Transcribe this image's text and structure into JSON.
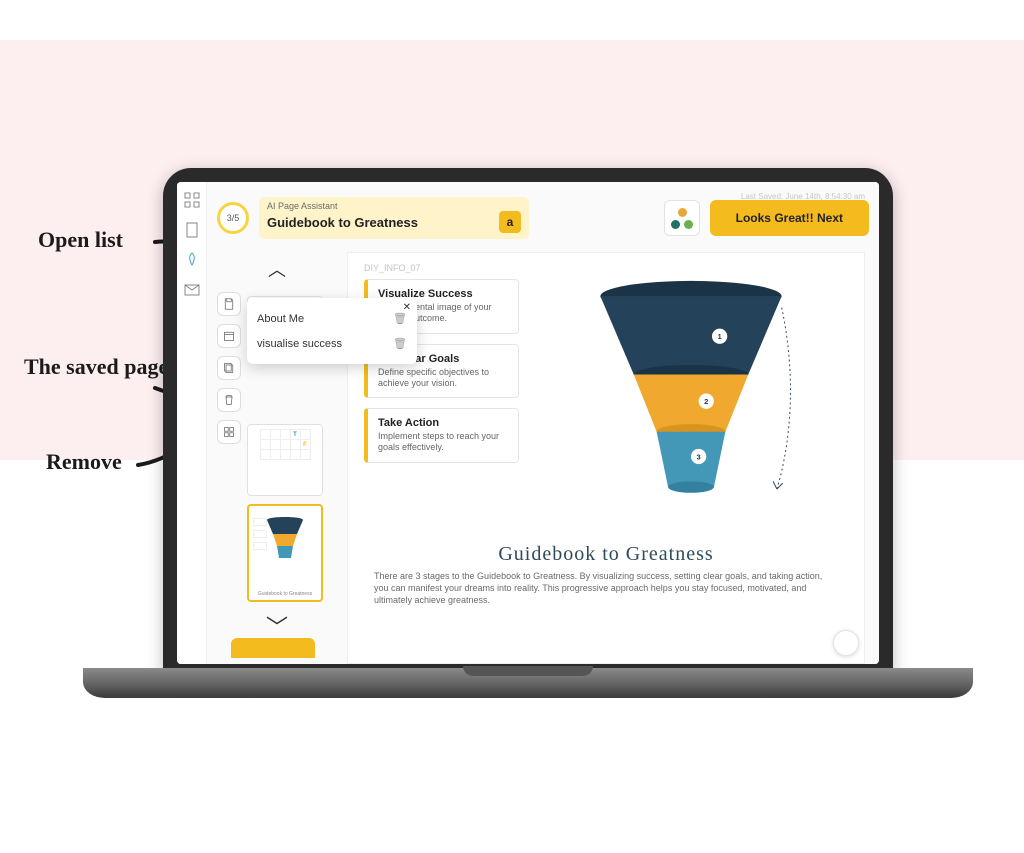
{
  "annotations": {
    "open_list": "Open list",
    "saved_page": "The saved page",
    "remove": "Remove"
  },
  "header": {
    "progress": "3/5",
    "assistant_label": "AI Page Assistant",
    "assistant_title": "Guidebook to Greatness",
    "next_label": "Looks Great!! Next",
    "last_saved": "Last Saved: June 14th, 8:54:30 am"
  },
  "popout": {
    "items": [
      {
        "label": "About Me"
      },
      {
        "label": "visualise success"
      }
    ]
  },
  "canvas": {
    "label": "DIY_INFO_07",
    "steps": [
      {
        "title": "Visualize Success",
        "desc": "Create mental image of your desired outcome."
      },
      {
        "title": "Set Clear Goals",
        "desc": "Define specific objectives to achieve your vision."
      },
      {
        "title": "Take Action",
        "desc": "Implement steps to reach your goals effectively."
      }
    ],
    "title": "Guidebook to Greatness",
    "desc": "There are 3 stages to the Guidebook to Greatness. By visualizing success, setting clear goals, and taking action, you can manifest your dreams into reality. This progressive approach helps you stay focused, motivated, and ultimately achieve greatness."
  },
  "chart_data": {
    "type": "other",
    "shape": "funnel",
    "stages": [
      {
        "index": 1,
        "label": "Visualize Success",
        "color": "#24425a"
      },
      {
        "index": 2,
        "label": "Set Clear Goals",
        "color": "#f0a92e"
      },
      {
        "index": 3,
        "label": "Take Action",
        "color": "#4398b8"
      }
    ],
    "title": "Guidebook to Greatness"
  }
}
